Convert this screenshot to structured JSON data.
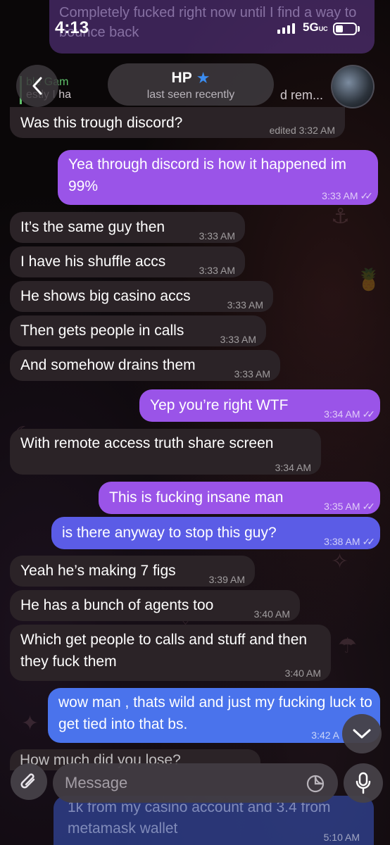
{
  "status_bar": {
    "time": "4:13",
    "network": "5G",
    "network_sub": "UC"
  },
  "header": {
    "name": "HP",
    "status": "last seen recently"
  },
  "ghost_top_text": "Completely fucked right now until I find a way to bounce back",
  "reply": {
    "author": "ble Gam",
    "text_left": "estly I ha",
    "text_right": "d rem..."
  },
  "messages": [
    {
      "text": "Was this trough discord?",
      "meta": "edited 3:32 AM",
      "dir": "in"
    },
    {
      "text": "Yea through discord is how it happened im 99%",
      "meta": "3:33 AM",
      "dir": "out"
    },
    {
      "text": "It’s the same guy then",
      "meta": "3:33 AM",
      "dir": "in"
    },
    {
      "text": "I have his shuffle accs",
      "meta": "3:33 AM",
      "dir": "in"
    },
    {
      "text": "He shows big casino accs",
      "meta": "3:33 AM",
      "dir": "in"
    },
    {
      "text": "Then gets people in calls",
      "meta": "3:33 AM",
      "dir": "in"
    },
    {
      "text": "And somehow drains them",
      "meta": "3:33 AM",
      "dir": "in"
    },
    {
      "text": "Yep you’re right WTF",
      "meta": "3:34 AM",
      "dir": "out"
    },
    {
      "text": "With remote access truth share screen",
      "meta": "3:34 AM",
      "dir": "in"
    },
    {
      "text": "This is fucking insane man",
      "meta": "3:35 AM",
      "dir": "out"
    },
    {
      "text": "is there anyway to stop this guy?",
      "meta": "3:38 AM",
      "dir": "out"
    },
    {
      "text": "Yeah he’s making 7 figs",
      "meta": "3:39 AM",
      "dir": "in"
    },
    {
      "text": "He has a bunch of agents too",
      "meta": "3:40 AM",
      "dir": "in"
    },
    {
      "text": "Which get people to calls and stuff and then they fuck them",
      "meta": "3:40 AM",
      "dir": "in"
    },
    {
      "text": "wow man , thats wild and just my fucking luck to get tied into that bs.",
      "meta": "3:42 A",
      "dir": "out"
    },
    {
      "text": "How much did you lose?",
      "meta": "",
      "dir": "in"
    },
    {
      "text": "1k from my casino account and 3.4 from metamask wallet",
      "meta": "5:10 AM",
      "dir": "out"
    }
  ],
  "input": {
    "placeholder": "Message"
  },
  "colors": {
    "outgoing": "#9a54e8",
    "incoming": "#2b2327",
    "accent": "#3b8cf0"
  }
}
